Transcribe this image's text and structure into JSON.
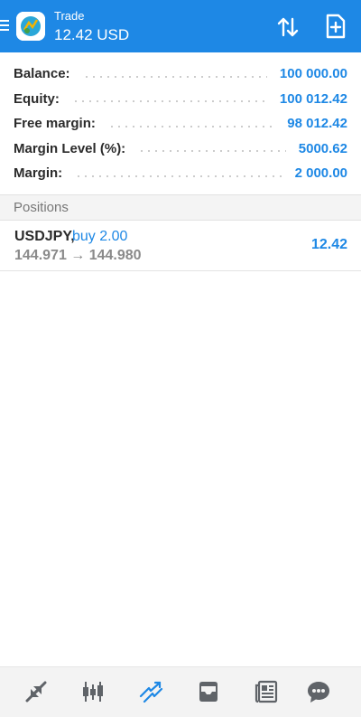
{
  "header": {
    "subtitle": "Trade",
    "title": "12.42 USD"
  },
  "summary": [
    {
      "label": "Balance:",
      "value": "100 000.00"
    },
    {
      "label": "Equity:",
      "value": "100 012.42"
    },
    {
      "label": "Free margin:",
      "value": "98 012.42"
    },
    {
      "label": "Margin Level (%):",
      "value": "5000.62"
    },
    {
      "label": "Margin:",
      "value": "2 000.00"
    }
  ],
  "positions": {
    "section_title": "Positions",
    "items": [
      {
        "symbol": "USDJPY,",
        "side": "buy 2.00",
        "prices": "144.971 → 144.980",
        "profit": "12.42"
      }
    ]
  },
  "bottom_nav": {
    "items": [
      "quotes-icon",
      "chart-icon",
      "trade-icon",
      "history-icon",
      "news-icon",
      "messages-icon"
    ],
    "active": "trade-icon"
  },
  "colors": {
    "accent": "#1e88e5",
    "icon_gray": "#5f6368"
  }
}
